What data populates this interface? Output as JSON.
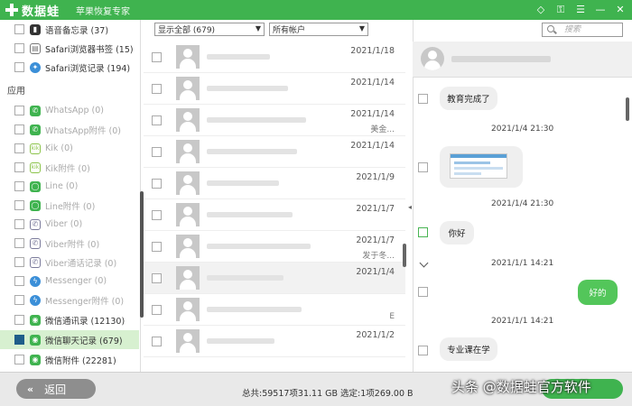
{
  "titlebar": {
    "brand": "数据蛙",
    "subtitle": "苹果恢复专家",
    "icons": [
      "diamond-icon",
      "key-icon",
      "menu-icon",
      "minimize-icon",
      "close-icon"
    ]
  },
  "sidebar": {
    "top_items": [
      {
        "label": "语音备忘录 (37)",
        "icon": "voice-memo-icon",
        "color": "#333333"
      },
      {
        "label": "Safari浏览器书签 (15)",
        "icon": "safari-bookmark-icon",
        "color": "#777777"
      },
      {
        "label": "Safari浏览记录 (194)",
        "icon": "safari-history-icon",
        "color": "#3b8fd8"
      }
    ],
    "section_label": "应用",
    "app_items": [
      {
        "label": "WhatsApp (0)",
        "icon": "whatsapp-icon",
        "color": "#3fb34f",
        "muted": true
      },
      {
        "label": "WhatsApp附件 (0)",
        "icon": "whatsapp-icon",
        "color": "#3fb34f",
        "muted": true
      },
      {
        "label": "Kik (0)",
        "icon": "kik-icon",
        "color": "#8bc34a",
        "muted": true
      },
      {
        "label": "Kik附件 (0)",
        "icon": "kik-icon",
        "color": "#8bc34a",
        "muted": true
      },
      {
        "label": "Line (0)",
        "icon": "line-icon",
        "color": "#3fb34f",
        "muted": true
      },
      {
        "label": "Line附件 (0)",
        "icon": "line-icon",
        "color": "#3fb34f",
        "muted": true
      },
      {
        "label": "Viber (0)",
        "icon": "viber-icon",
        "color": "#7b7b9b",
        "muted": true
      },
      {
        "label": "Viber附件 (0)",
        "icon": "viber-icon",
        "color": "#7b7b9b",
        "muted": true
      },
      {
        "label": "Viber通话记录 (0)",
        "icon": "viber-icon",
        "color": "#7b7b9b",
        "muted": true
      },
      {
        "label": "Messenger (0)",
        "icon": "messenger-icon",
        "color": "#3b8fd8",
        "muted": true
      },
      {
        "label": "Messenger附件 (0)",
        "icon": "messenger-icon",
        "color": "#3b8fd8",
        "muted": true
      },
      {
        "label": "微信通讯录 (12130)",
        "icon": "wechat-icon",
        "color": "#3fb34f",
        "muted": false
      },
      {
        "label": "微信聊天记录 (679)",
        "icon": "wechat-icon",
        "color": "#3fb34f",
        "muted": false,
        "selected": true
      },
      {
        "label": "微信附件 (22281)",
        "icon": "wechat-icon",
        "color": "#3fb34f",
        "muted": false
      }
    ]
  },
  "filters": {
    "show_all": "显示全部 (679)",
    "accounts": "所有帐户"
  },
  "search": {
    "placeholder": "搜索"
  },
  "list": {
    "rows": [
      {
        "date": "2021/1/18",
        "preview": ""
      },
      {
        "date": "2021/1/14",
        "preview": ""
      },
      {
        "date": "2021/1/14",
        "preview": "美金..."
      },
      {
        "date": "2021/1/14",
        "preview": ""
      },
      {
        "date": "2021/1/9",
        "preview": ""
      },
      {
        "date": "2021/1/7",
        "preview": ""
      },
      {
        "date": "2021/1/7",
        "preview": "发于冬..."
      },
      {
        "date": "2021/1/4",
        "preview": ""
      },
      {
        "date": "",
        "preview": "E"
      },
      {
        "date": "2021/1/2",
        "preview": ""
      }
    ]
  },
  "chat": {
    "messages": [
      {
        "text": "教育完成了",
        "side": "left"
      },
      {
        "timestamp": "2021/1/4 21:30"
      },
      {
        "image": true,
        "side": "left"
      },
      {
        "timestamp": "2021/1/4 21:30"
      },
      {
        "text": "你好",
        "side": "left"
      },
      {
        "timestamp": "2021/1/1 14:21"
      },
      {
        "text": "好的",
        "side": "right"
      },
      {
        "timestamp": "2021/1/1 14:21"
      },
      {
        "text": "专业课在学",
        "side": "left"
      }
    ],
    "colors": {
      "me_bubble": "#53c65a",
      "other_bubble": "#efefef"
    }
  },
  "bottom": {
    "back_label": "返回",
    "status": "总共:59517项31.11 GB 选定:1项269.00 B",
    "watermark": "头条 @数据蛙官方软件"
  },
  "colors": {
    "accent": "#3fb34f",
    "selected_row": "#d7f0d0"
  }
}
